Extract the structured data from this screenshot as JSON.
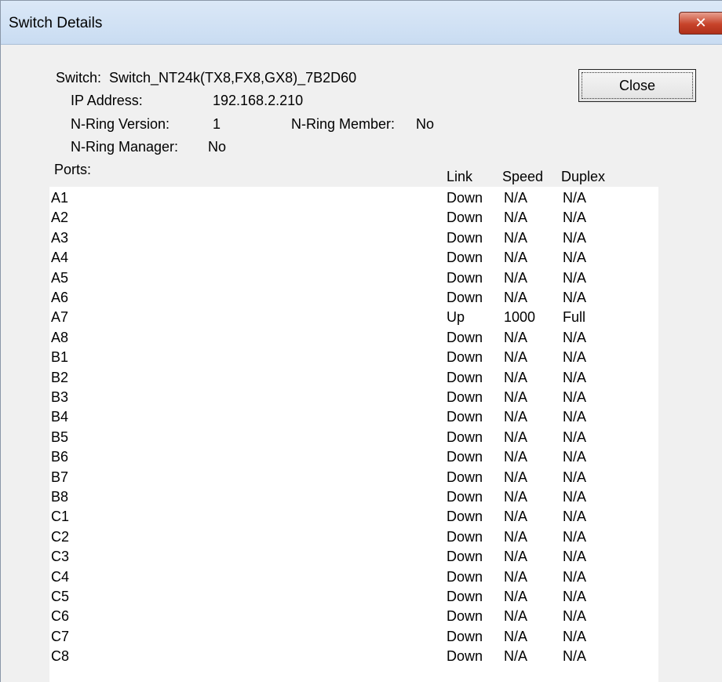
{
  "window": {
    "title": "Switch Details",
    "close_glyph": "✕"
  },
  "info": {
    "switch_label": "Switch:",
    "switch_name": "Switch_NT24k(TX8,FX8,GX8)_7B2D60",
    "ip_label": "IP Address:",
    "ip_value": "192.168.2.210",
    "ring_version_label": "N-Ring Version:",
    "ring_version_value": "1",
    "ring_member_label": "N-Ring Member:",
    "ring_member_value": "No",
    "ring_manager_label": "N-Ring Manager:",
    "ring_manager_value": "No"
  },
  "buttons": {
    "close": "Close"
  },
  "table": {
    "headers": {
      "ports": "Ports:",
      "link": "Link",
      "speed": "Speed",
      "duplex": "Duplex"
    },
    "rows": [
      {
        "port": "A1",
        "link": "Down",
        "speed": "N/A",
        "duplex": "N/A"
      },
      {
        "port": "A2",
        "link": "Down",
        "speed": "N/A",
        "duplex": "N/A"
      },
      {
        "port": "A3",
        "link": "Down",
        "speed": "N/A",
        "duplex": "N/A"
      },
      {
        "port": "A4",
        "link": "Down",
        "speed": "N/A",
        "duplex": "N/A"
      },
      {
        "port": "A5",
        "link": "Down",
        "speed": "N/A",
        "duplex": "N/A"
      },
      {
        "port": "A6",
        "link": "Down",
        "speed": "N/A",
        "duplex": "N/A"
      },
      {
        "port": "A7",
        "link": "Up",
        "speed": "1000",
        "duplex": "Full"
      },
      {
        "port": "A8",
        "link": "Down",
        "speed": "N/A",
        "duplex": "N/A"
      },
      {
        "port": "B1",
        "link": "Down",
        "speed": "N/A",
        "duplex": "N/A"
      },
      {
        "port": "B2",
        "link": "Down",
        "speed": "N/A",
        "duplex": "N/A"
      },
      {
        "port": "B3",
        "link": "Down",
        "speed": "N/A",
        "duplex": "N/A"
      },
      {
        "port": "B4",
        "link": "Down",
        "speed": "N/A",
        "duplex": "N/A"
      },
      {
        "port": "B5",
        "link": "Down",
        "speed": "N/A",
        "duplex": "N/A"
      },
      {
        "port": "B6",
        "link": "Down",
        "speed": "N/A",
        "duplex": "N/A"
      },
      {
        "port": "B7",
        "link": "Down",
        "speed": "N/A",
        "duplex": "N/A"
      },
      {
        "port": "B8",
        "link": "Down",
        "speed": "N/A",
        "duplex": "N/A"
      },
      {
        "port": "C1",
        "link": "Down",
        "speed": "N/A",
        "duplex": "N/A"
      },
      {
        "port": "C2",
        "link": "Down",
        "speed": "N/A",
        "duplex": "N/A"
      },
      {
        "port": "C3",
        "link": "Down",
        "speed": "N/A",
        "duplex": "N/A"
      },
      {
        "port": "C4",
        "link": "Down",
        "speed": "N/A",
        "duplex": "N/A"
      },
      {
        "port": "C5",
        "link": "Down",
        "speed": "N/A",
        "duplex": "N/A"
      },
      {
        "port": "C6",
        "link": "Down",
        "speed": "N/A",
        "duplex": "N/A"
      },
      {
        "port": "C7",
        "link": "Down",
        "speed": "N/A",
        "duplex": "N/A"
      },
      {
        "port": "C8",
        "link": "Down",
        "speed": "N/A",
        "duplex": "N/A"
      }
    ]
  }
}
